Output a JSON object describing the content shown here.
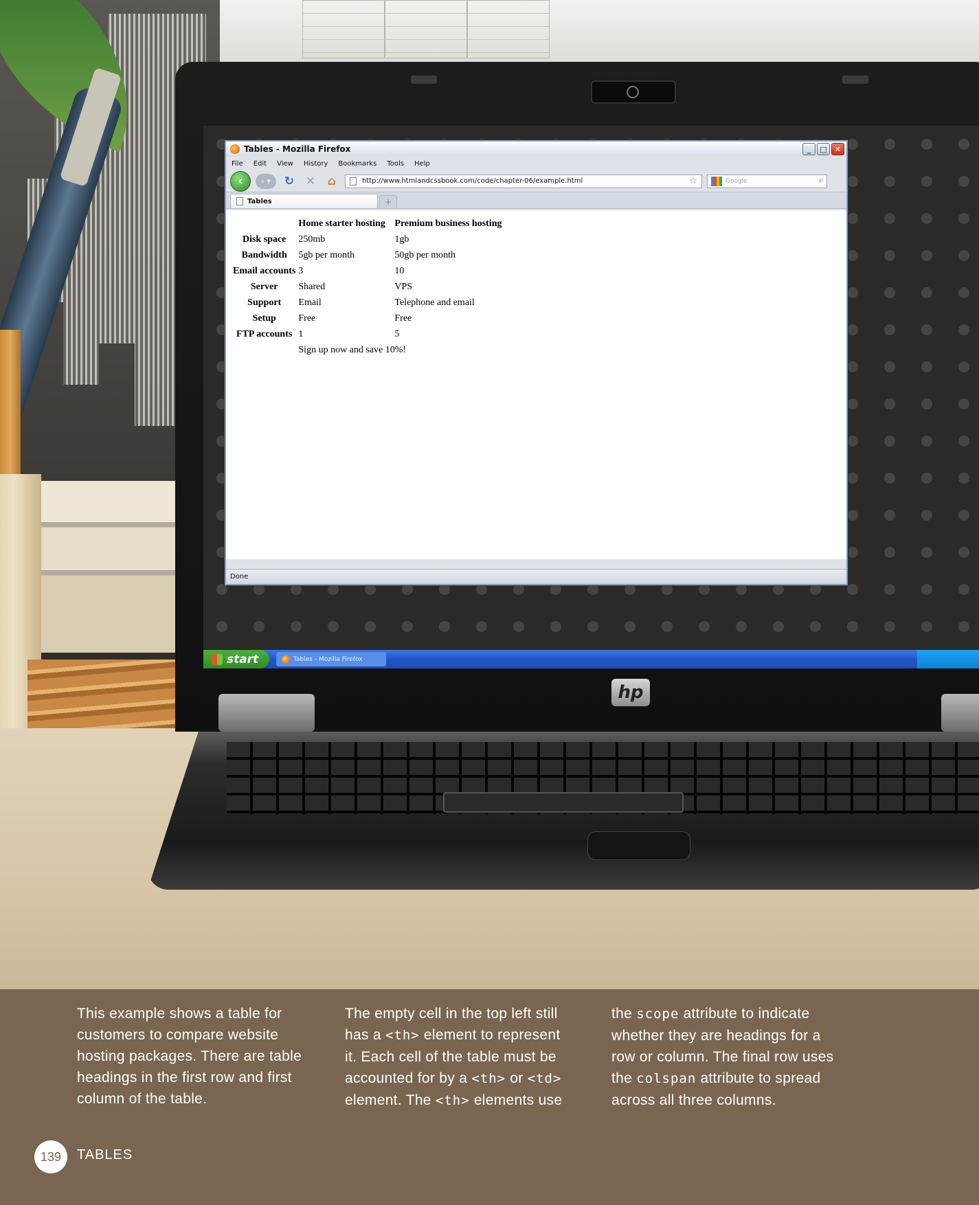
{
  "browser": {
    "window_title": "Tables - Mozilla Firefox",
    "menu": [
      "File",
      "Edit",
      "View",
      "History",
      "Bookmarks",
      "Tools",
      "Help"
    ],
    "url": "http://www.htmlandcssbook.com/code/chapter-06/example.html",
    "search_placeholder": "Google",
    "tab_label": "Tables",
    "new_tab_symbol": "+",
    "status": "Done"
  },
  "table": {
    "headers": [
      "",
      "Home starter hosting",
      "Premium business hosting"
    ],
    "rows": [
      {
        "label": "Disk space",
        "home": "250mb",
        "premium": "1gb"
      },
      {
        "label": "Bandwidth",
        "home": "5gb per month",
        "premium": "50gb per month"
      },
      {
        "label": "Email accounts",
        "home": "3",
        "premium": "10"
      },
      {
        "label": "Server",
        "home": "Shared",
        "premium": "VPS"
      },
      {
        "label": "Support",
        "home": "Email",
        "premium": "Telephone and email"
      },
      {
        "label": "Setup",
        "home": "Free",
        "premium": "Free"
      },
      {
        "label": "FTP accounts",
        "home": "1",
        "premium": "5"
      }
    ],
    "footer": "Sign up now and save 10%!"
  },
  "taskbar": {
    "start_label": "start",
    "task_label": "Tables - Mozilla Firefox"
  },
  "laptop": {
    "logo": "hp"
  },
  "caption": {
    "col1": "This example shows a table for customers to compare website hosting packages. There are table headings in the first row and first column of the table.",
    "col2": {
      "p1": "The empty cell in the top left still has a ",
      "c1": "<th>",
      "p2": " element to represent it. Each cell of the table must be accounted for by a ",
      "c2": "<th>",
      "p3": " or ",
      "c3": "<td>",
      "p4": " element. The ",
      "c4": "<th>",
      "p5": " elements use"
    },
    "col3": {
      "p1": "the ",
      "c1": "scope",
      "p2": " attribute to indicate whether they are headings for a row or column. The final row uses the ",
      "c2": "colspan",
      "p3": " attribute to spread across all three columns."
    }
  },
  "footer": {
    "page_number": "139",
    "section": "TABLES"
  },
  "colors": {
    "caption_bg": "#7a6650",
    "xp_start_green": "#2f8c27",
    "xp_taskbar_blue": "#1f56c6"
  }
}
